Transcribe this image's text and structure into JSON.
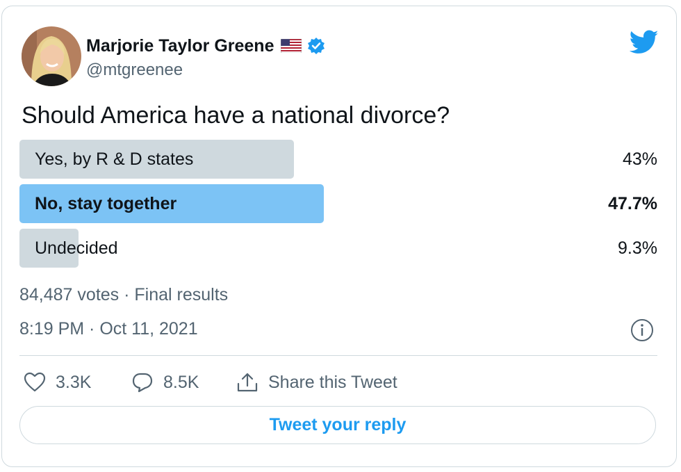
{
  "author": {
    "name": "Marjorie Taylor Greene",
    "handle": "@mtgreenee",
    "flag_icon": "us-flag-icon",
    "verified_icon": "verified-badge-icon",
    "avatar_icon": "profile-avatar"
  },
  "brand": {
    "icon": "twitter-bird-icon",
    "color": "#1d9bf0"
  },
  "tweet": {
    "text": "Should America have a national divorce?"
  },
  "poll": {
    "options": [
      {
        "label": "Yes, by R & D states",
        "percent_label": "43%",
        "percent": 43,
        "winner": false,
        "bar_color": "#cfd9de"
      },
      {
        "label": "No, stay together",
        "percent_label": "47.7%",
        "percent": 47.7,
        "winner": true,
        "bar_color": "#7cc3f5"
      },
      {
        "label": "Undecided",
        "percent_label": "9.3%",
        "percent": 9.3,
        "winner": false,
        "bar_color": "#cfd9de"
      }
    ],
    "summary": "84,487 votes · Final results"
  },
  "meta": {
    "timestamp": "8:19 PM · Oct 11, 2021",
    "info_icon": "info-icon"
  },
  "actions": {
    "likes": {
      "icon": "heart-icon",
      "count": "3.3K"
    },
    "replies": {
      "icon": "reply-icon",
      "count": "8.5K"
    },
    "share": {
      "icon": "share-icon",
      "label": "Share this Tweet"
    }
  },
  "reply_button": {
    "label": "Tweet your reply"
  }
}
